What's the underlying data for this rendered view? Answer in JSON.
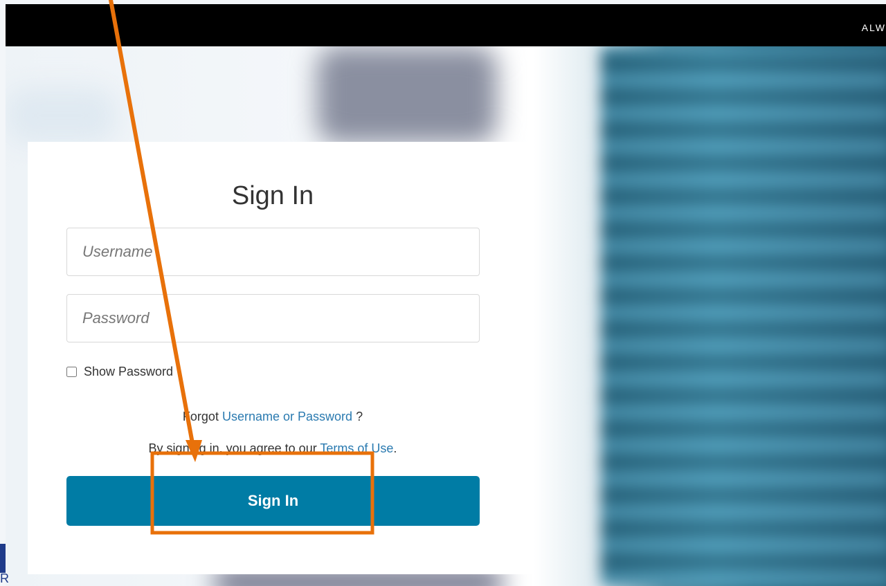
{
  "header": {
    "brand_text": "ALW"
  },
  "login": {
    "title": "Sign In",
    "username_placeholder": "Username",
    "password_placeholder": "Password",
    "show_password_label": "Show Password",
    "forgot_prefix": "Forgot",
    "forgot_link": "Username or Password",
    "forgot_suffix": "?",
    "terms_prefix": "By signing in, you agree to our",
    "terms_link": "Terms of Use",
    "terms_suffix": ".",
    "submit_label": "Sign In"
  },
  "annotation": {
    "color": "#e8710a",
    "type": "arrow-and-box"
  },
  "corner": {
    "letter": "R"
  },
  "colors": {
    "button": "#007ca5",
    "link": "#2a7ab0",
    "topbar": "#000000"
  }
}
